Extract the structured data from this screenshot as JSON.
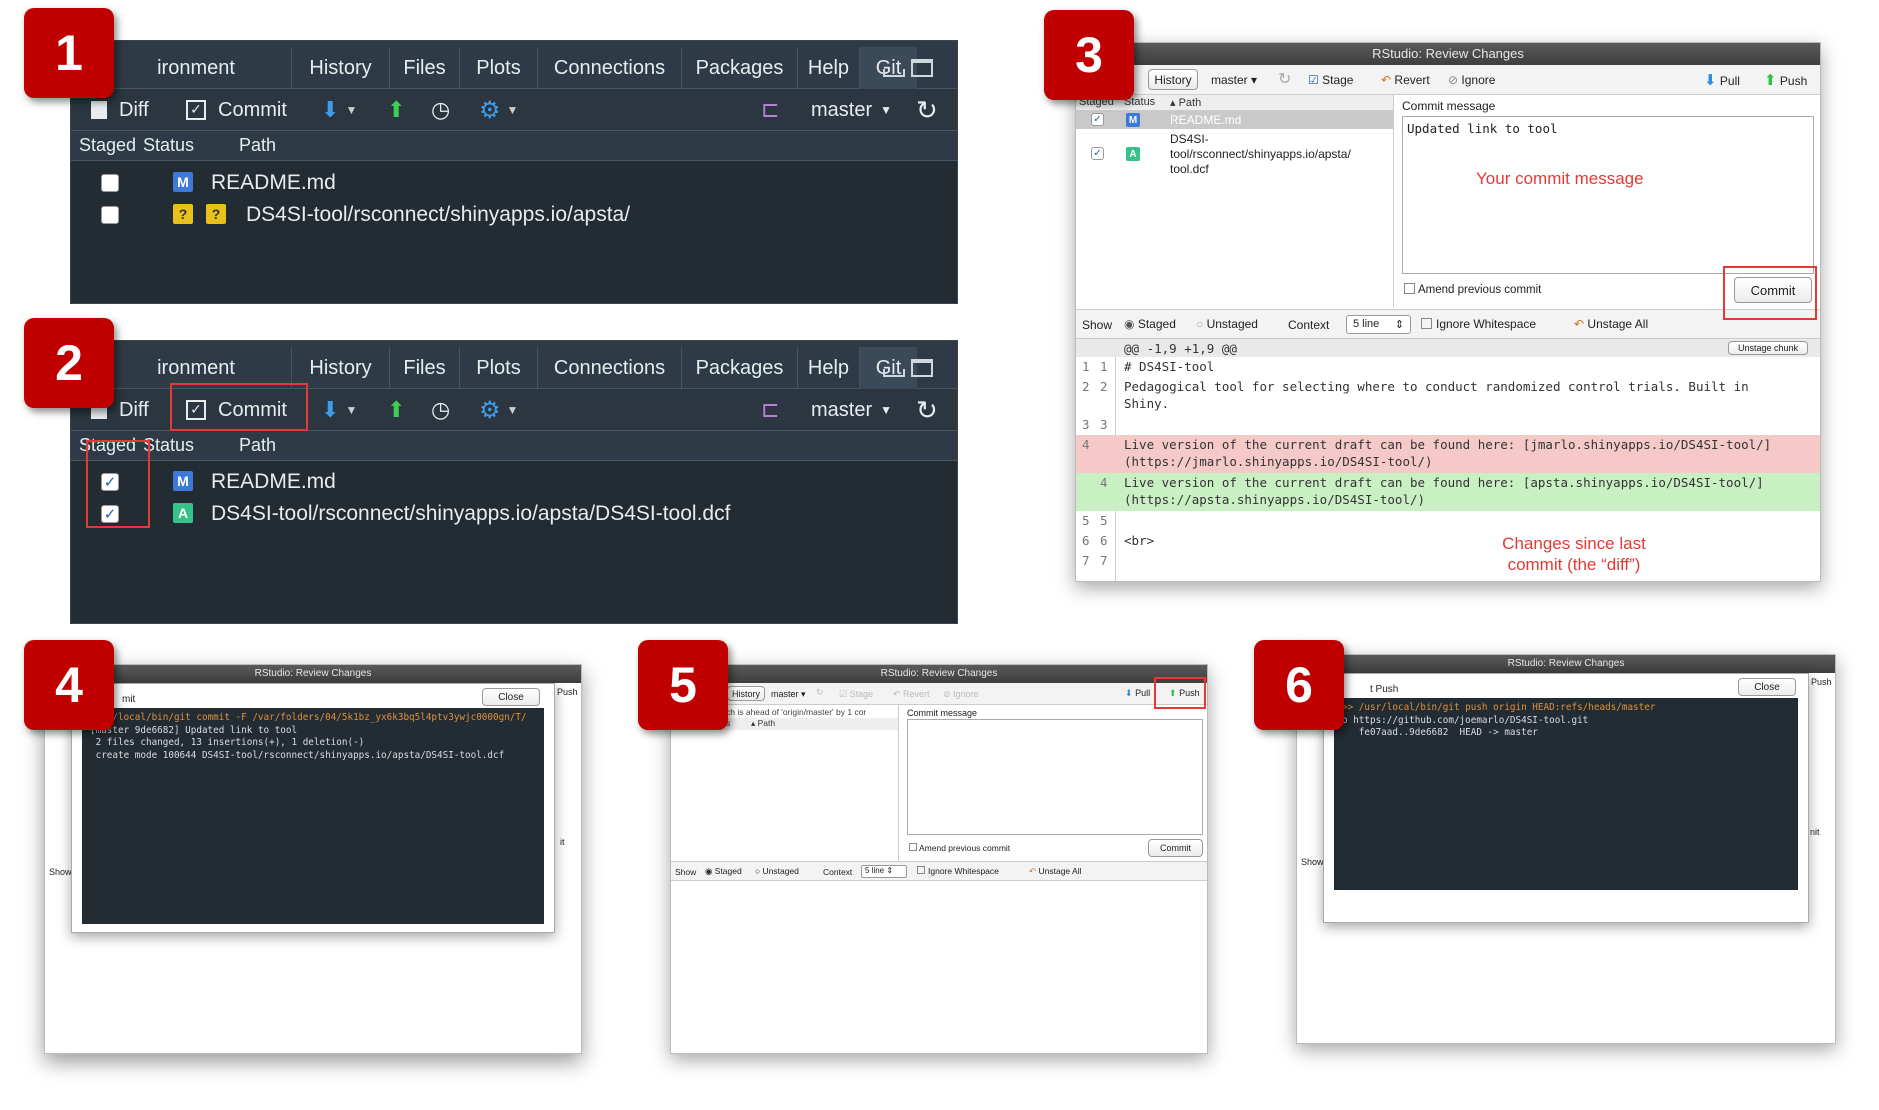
{
  "badges": [
    "1",
    "2",
    "3",
    "4",
    "5",
    "6"
  ],
  "git_pane": {
    "tabs": [
      "ironment",
      "History",
      "Files",
      "Plots",
      "Connections",
      "Packages",
      "Help",
      "Git"
    ],
    "diff_label": "Diff",
    "commit_label": "Commit",
    "branch": "master",
    "columns": {
      "staged": "Staged",
      "status": "Status",
      "path": "Path"
    },
    "panel1_rows": [
      {
        "path": "README.md",
        "status": "M"
      },
      {
        "path": "DS4SI-tool/rsconnect/shinyapps.io/apsta/",
        "status": "??"
      }
    ],
    "panel2_rows": [
      {
        "path": "README.md",
        "status": "M"
      },
      {
        "path": "DS4SI-tool/rsconnect/shinyapps.io/apsta/DS4SI-tool.dcf",
        "status": "A"
      }
    ]
  },
  "review": {
    "title": "RStudio: Review Changes",
    "toolbar": {
      "history": "History",
      "branch": "master",
      "stage": "Stage",
      "revert": "Revert",
      "ignore": "Ignore",
      "pull": "Pull",
      "push": "Push"
    },
    "columns": {
      "staged": "Staged",
      "status": "Status",
      "path": "Path"
    },
    "files": [
      {
        "path": "README.md",
        "status": "M"
      },
      {
        "path_lines": [
          "DS4SI-",
          "tool/rsconnect/shinyapps.io/apsta/",
          "tool.dcf"
        ],
        "status": "A"
      }
    ],
    "commit_message_label": "Commit message",
    "commit_message": "Updated link to tool",
    "annotation_message": "Your commit message",
    "amend_label": "Amend previous commit",
    "commit_button": "Commit",
    "show_bar": {
      "show": "Show",
      "staged": "Staged",
      "unstaged": "Unstaged",
      "context": "Context",
      "context_value": "5 line",
      "ignore_ws": "Ignore Whitespace",
      "unstage_all": "Unstage All"
    },
    "hunk_header": "@@ -1,9 +1,9 @@",
    "unstage_chunk": "Unstage chunk",
    "diff_lines": [
      {
        "old": "1",
        "new": "1",
        "text": "# DS4SI-tool",
        "type": "ctx"
      },
      {
        "old": "2",
        "new": "2",
        "text": "Pedagogical tool for selecting where to conduct randomized control trials. Built in",
        "text2": "Shiny.",
        "type": "ctx"
      },
      {
        "old": "3",
        "new": "3",
        "text": "",
        "type": "ctx"
      },
      {
        "old": "4",
        "new": "",
        "text": "Live version of the current draft can be found here: [jmarlo.shinyapps.io/DS4SI-tool/]",
        "text2": "(https://jmarlo.shinyapps.io/DS4SI-tool/)",
        "type": "del"
      },
      {
        "old": "",
        "new": "4",
        "text": "Live version of the current draft can be found here: [apsta.shinyapps.io/DS4SI-tool/]",
        "text2": "(https://apsta.shinyapps.io/DS4SI-tool/)",
        "type": "add"
      },
      {
        "old": "5",
        "new": "5",
        "text": "",
        "type": "ctx"
      },
      {
        "old": "6",
        "new": "6",
        "text": "<br>",
        "type": "ctx"
      },
      {
        "old": "7",
        "new": "7",
        "text": "",
        "type": "ctx"
      }
    ],
    "annotation_diff": [
      "Changes since last",
      "commit (the “diff”)"
    ]
  },
  "win4": {
    "title": "RStudio: Review Changes",
    "heading": "mit",
    "close": "Close",
    "push": "Push",
    "show": "Show",
    "it": "it",
    "lines": [
      "/usr/local/bin/git commit -F /var/folders/04/5k1bz_yx6k3bq5l4ptv3ywjc0000gn/T/",
      "[master 9de6682] Updated link to tool",
      " 2 files changed, 13 insertions(+), 1 deletion(-)",
      " create mode 100644 DS4SI-tool/rsconnect/shinyapps.io/apsta/DS4SI-tool.dcf"
    ]
  },
  "win5": {
    "title": "RStudio: Review Changes",
    "toolbar": {
      "history": "History",
      "branch": "master",
      "stage": "Stage",
      "revert": "Revert",
      "ignore": "Ignore",
      "pull": "Pull",
      "push": "Push"
    },
    "ahead": "ch is ahead of 'origin/master' by 1 cor",
    "status_col": "s",
    "path_col": "Path",
    "commit_message_label": "Commit message",
    "amend_label": "Amend previous commit",
    "commit_button": "Commit",
    "show_bar": {
      "show": "Show",
      "staged": "Staged",
      "unstaged": "Unstaged",
      "context": "Context",
      "context_value": "5 line",
      "ignore_ws": "Ignore Whitespace",
      "unstage_all": "Unstage All"
    }
  },
  "win6": {
    "title": "RStudio: Review Changes",
    "heading": "t Push",
    "close": "Close",
    "push": "Push",
    "show": "Show",
    "it": "nit",
    "lines": [
      ">> /usr/local/bin/git push origin HEAD:refs/heads/master",
      "o https://github.com/joemarlo/DS4SI-tool.git",
      "   fe07aad..9de6682  HEAD -> master"
    ]
  }
}
